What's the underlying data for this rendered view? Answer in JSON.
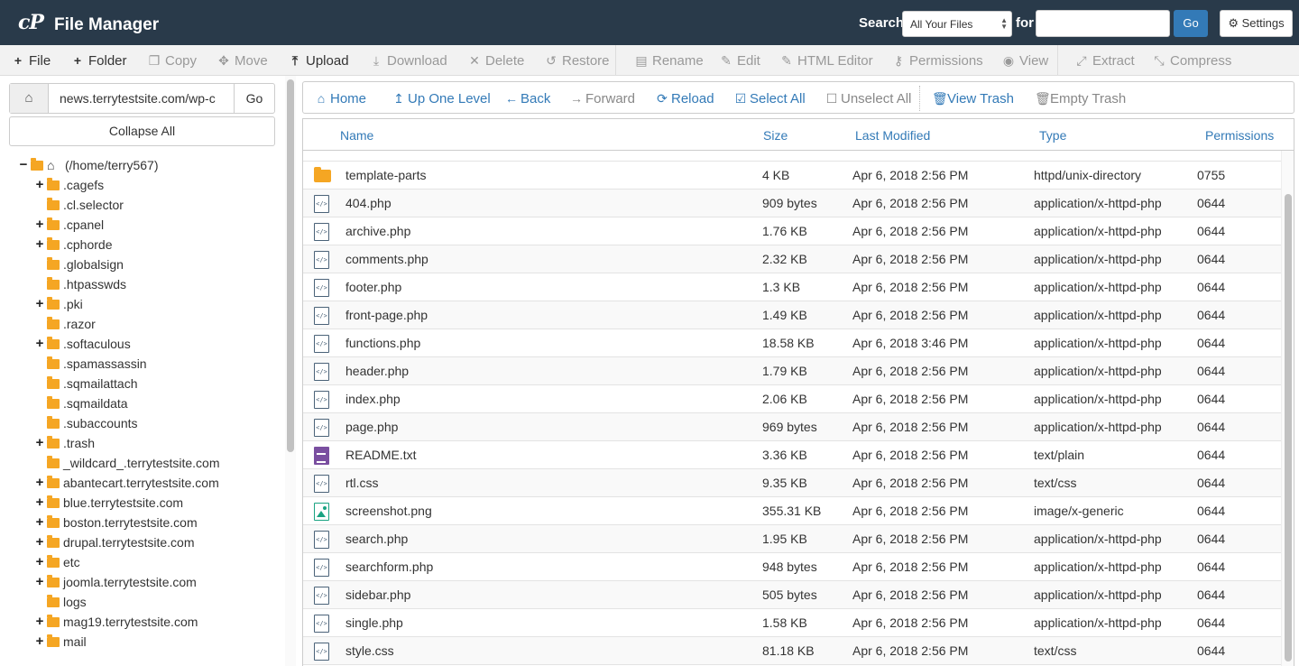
{
  "header": {
    "logo": "cP",
    "title": "File Manager",
    "search_label": "Search",
    "search_scope": "All Your Files",
    "for_label": "for",
    "search_value": "",
    "go_label": "Go",
    "settings_label": "Settings"
  },
  "toolbar": [
    {
      "name": "file",
      "label": "File",
      "icon": "plus-icon",
      "glyph": "+",
      "disabled": false
    },
    {
      "name": "folder",
      "label": "Folder",
      "icon": "plus-icon",
      "glyph": "+",
      "disabled": false
    },
    {
      "name": "copy",
      "label": "Copy",
      "icon": "copy-icon",
      "glyph": "❐",
      "disabled": true
    },
    {
      "name": "move",
      "label": "Move",
      "icon": "move-icon",
      "glyph": "✥",
      "disabled": true
    },
    {
      "name": "upload",
      "label": "Upload",
      "icon": "upload-icon",
      "glyph": "⤒",
      "disabled": false
    },
    {
      "name": "download",
      "label": "Download",
      "icon": "download-icon",
      "glyph": "⤓",
      "disabled": true
    },
    {
      "name": "delete",
      "label": "Delete",
      "icon": "times-icon",
      "glyph": "✕",
      "disabled": true
    },
    {
      "name": "restore",
      "label": "Restore",
      "icon": "undo-icon",
      "glyph": "↺",
      "disabled": true
    },
    {
      "name": "rename",
      "label": "Rename",
      "icon": "file-icon",
      "glyph": "▤",
      "disabled": true
    },
    {
      "name": "edit",
      "label": "Edit",
      "icon": "pencil-icon",
      "glyph": "✎",
      "disabled": true
    },
    {
      "name": "html-editor",
      "label": "HTML Editor",
      "icon": "edit-icon",
      "glyph": "✎",
      "disabled": true
    },
    {
      "name": "permissions",
      "label": "Permissions",
      "icon": "key-icon",
      "glyph": "⚷",
      "disabled": true
    },
    {
      "name": "view",
      "label": "View",
      "icon": "eye-icon",
      "glyph": "◉",
      "disabled": true
    },
    {
      "name": "extract",
      "label": "Extract",
      "icon": "expand-icon",
      "glyph": "⤢",
      "disabled": true
    },
    {
      "name": "compress",
      "label": "Compress",
      "icon": "compress-icon",
      "glyph": "⤡",
      "disabled": true
    }
  ],
  "left": {
    "path_value": "news.terrytestsite.com/wp-c",
    "go_label": "Go",
    "collapse_label": "Collapse All",
    "tree": [
      {
        "label": "(/home/terry567)",
        "toggle": "−",
        "root": true
      },
      {
        "label": ".cagefs",
        "toggle": "+"
      },
      {
        "label": ".cl.selector",
        "toggle": ""
      },
      {
        "label": ".cpanel",
        "toggle": "+"
      },
      {
        "label": ".cphorde",
        "toggle": "+"
      },
      {
        "label": ".globalsign",
        "toggle": ""
      },
      {
        "label": ".htpasswds",
        "toggle": ""
      },
      {
        "label": ".pki",
        "toggle": "+"
      },
      {
        "label": ".razor",
        "toggle": ""
      },
      {
        "label": ".softaculous",
        "toggle": "+"
      },
      {
        "label": ".spamassassin",
        "toggle": ""
      },
      {
        "label": ".sqmailattach",
        "toggle": ""
      },
      {
        "label": ".sqmaildata",
        "toggle": ""
      },
      {
        "label": ".subaccounts",
        "toggle": ""
      },
      {
        "label": ".trash",
        "toggle": "+"
      },
      {
        "label": "_wildcard_.terrytestsite.com",
        "toggle": ""
      },
      {
        "label": "abantecart.terrytestsite.com",
        "toggle": "+"
      },
      {
        "label": "blue.terrytestsite.com",
        "toggle": "+"
      },
      {
        "label": "boston.terrytestsite.com",
        "toggle": "+"
      },
      {
        "label": "drupal.terrytestsite.com",
        "toggle": "+"
      },
      {
        "label": "etc",
        "toggle": "+"
      },
      {
        "label": "joomla.terrytestsite.com",
        "toggle": "+"
      },
      {
        "label": "logs",
        "toggle": ""
      },
      {
        "label": "mag19.terrytestsite.com",
        "toggle": "+"
      },
      {
        "label": "mail",
        "toggle": "+"
      }
    ]
  },
  "nav": [
    {
      "name": "home",
      "label": "Home",
      "icon": "home-icon",
      "glyph": "⌂",
      "disabled": false
    },
    {
      "name": "up-one-level",
      "label": "Up One Level",
      "icon": "level-up-icon",
      "glyph": "↥",
      "disabled": false
    },
    {
      "name": "back",
      "label": "Back",
      "icon": "arrow-left-icon",
      "glyph": "←",
      "disabled": false
    },
    {
      "name": "forward",
      "label": "Forward",
      "icon": "arrow-right-icon",
      "glyph": "→",
      "disabled": true
    },
    {
      "name": "reload",
      "label": "Reload",
      "icon": "refresh-icon",
      "glyph": "⟳",
      "disabled": false
    },
    {
      "name": "select-all",
      "label": "Select All",
      "icon": "check-square-icon",
      "glyph": "☑",
      "disabled": false
    },
    {
      "name": "unselect-all",
      "label": "Unselect All",
      "icon": "square-icon",
      "glyph": "☐",
      "disabled": true
    },
    {
      "name": "view-trash",
      "label": "View Trash",
      "icon": "trash-icon",
      "glyph": "🗑",
      "disabled": false
    },
    {
      "name": "empty-trash",
      "label": "Empty Trash",
      "icon": "trash-icon",
      "glyph": "🗑",
      "disabled": true
    }
  ],
  "table": {
    "columns": [
      "Name",
      "Size",
      "Last Modified",
      "Type",
      "Permissions"
    ],
    "rows": [
      {
        "icon": "folder",
        "name": "template-parts",
        "size": "4 KB",
        "modified": "Apr 6, 2018 2:56 PM",
        "type": "httpd/unix-directory",
        "perms": "0755"
      },
      {
        "icon": "code",
        "name": "404.php",
        "size": "909 bytes",
        "modified": "Apr 6, 2018 2:56 PM",
        "type": "application/x-httpd-php",
        "perms": "0644"
      },
      {
        "icon": "code",
        "name": "archive.php",
        "size": "1.76 KB",
        "modified": "Apr 6, 2018 2:56 PM",
        "type": "application/x-httpd-php",
        "perms": "0644"
      },
      {
        "icon": "code",
        "name": "comments.php",
        "size": "2.32 KB",
        "modified": "Apr 6, 2018 2:56 PM",
        "type": "application/x-httpd-php",
        "perms": "0644"
      },
      {
        "icon": "code",
        "name": "footer.php",
        "size": "1.3 KB",
        "modified": "Apr 6, 2018 2:56 PM",
        "type": "application/x-httpd-php",
        "perms": "0644"
      },
      {
        "icon": "code",
        "name": "front-page.php",
        "size": "1.49 KB",
        "modified": "Apr 6, 2018 2:56 PM",
        "type": "application/x-httpd-php",
        "perms": "0644"
      },
      {
        "icon": "code",
        "name": "functions.php",
        "size": "18.58 KB",
        "modified": "Apr 6, 2018 3:46 PM",
        "type": "application/x-httpd-php",
        "perms": "0644"
      },
      {
        "icon": "code",
        "name": "header.php",
        "size": "1.79 KB",
        "modified": "Apr 6, 2018 2:56 PM",
        "type": "application/x-httpd-php",
        "perms": "0644"
      },
      {
        "icon": "code",
        "name": "index.php",
        "size": "2.06 KB",
        "modified": "Apr 6, 2018 2:56 PM",
        "type": "application/x-httpd-php",
        "perms": "0644"
      },
      {
        "icon": "code",
        "name": "page.php",
        "size": "969 bytes",
        "modified": "Apr 6, 2018 2:56 PM",
        "type": "application/x-httpd-php",
        "perms": "0644"
      },
      {
        "icon": "text",
        "name": "README.txt",
        "size": "3.36 KB",
        "modified": "Apr 6, 2018 2:56 PM",
        "type": "text/plain",
        "perms": "0644"
      },
      {
        "icon": "code",
        "name": "rtl.css",
        "size": "9.35 KB",
        "modified": "Apr 6, 2018 2:56 PM",
        "type": "text/css",
        "perms": "0644"
      },
      {
        "icon": "image",
        "name": "screenshot.png",
        "size": "355.31 KB",
        "modified": "Apr 6, 2018 2:56 PM",
        "type": "image/x-generic",
        "perms": "0644"
      },
      {
        "icon": "code",
        "name": "search.php",
        "size": "1.95 KB",
        "modified": "Apr 6, 2018 2:56 PM",
        "type": "application/x-httpd-php",
        "perms": "0644"
      },
      {
        "icon": "code",
        "name": "searchform.php",
        "size": "948 bytes",
        "modified": "Apr 6, 2018 2:56 PM",
        "type": "application/x-httpd-php",
        "perms": "0644"
      },
      {
        "icon": "code",
        "name": "sidebar.php",
        "size": "505 bytes",
        "modified": "Apr 6, 2018 2:56 PM",
        "type": "application/x-httpd-php",
        "perms": "0644"
      },
      {
        "icon": "code",
        "name": "single.php",
        "size": "1.58 KB",
        "modified": "Apr 6, 2018 2:56 PM",
        "type": "application/x-httpd-php",
        "perms": "0644"
      },
      {
        "icon": "code",
        "name": "style.css",
        "size": "81.18 KB",
        "modified": "Apr 6, 2018 2:56 PM",
        "type": "text/css",
        "perms": "0644"
      }
    ]
  },
  "colors": {
    "header_bg": "#293a4a",
    "link_blue": "#337ab7",
    "folder": "#f5a623"
  }
}
